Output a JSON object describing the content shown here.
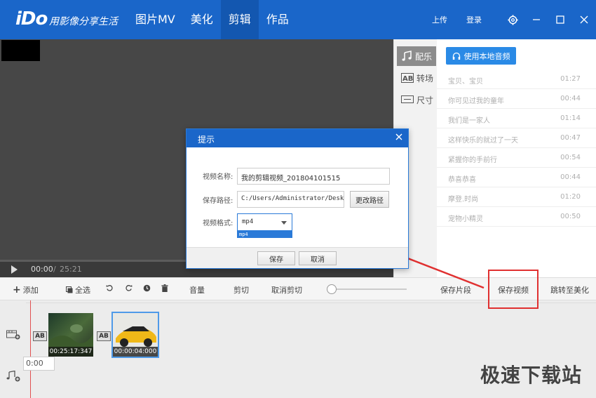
{
  "app": {
    "logo": "iDo",
    "slogan": "用影像分享生活"
  },
  "nav": [
    {
      "label": "图片MV"
    },
    {
      "label": "美化"
    },
    {
      "label": "剪辑"
    },
    {
      "label": "作品"
    }
  ],
  "top_links": {
    "upload": "上传",
    "login": "登录"
  },
  "player": {
    "current_time": "00:00",
    "separator": "/",
    "total_time": "25:21"
  },
  "side_tabs": [
    {
      "label": "配乐",
      "icon": "music-note-icon"
    },
    {
      "label": "转场",
      "icon": "ab-transition-icon"
    },
    {
      "label": "尺寸",
      "icon": "size-icon"
    }
  ],
  "music": {
    "local_button": "使用本地音频",
    "items": [
      {
        "title": "宝贝、宝贝",
        "duration": "01:27"
      },
      {
        "title": "你可见过我的童年",
        "duration": "00:44"
      },
      {
        "title": "我们是一家人",
        "duration": "01:14"
      },
      {
        "title": "这样快乐的就过了一天",
        "duration": "00:47"
      },
      {
        "title": "紧握你的手前行",
        "duration": "00:54"
      },
      {
        "title": "恭喜恭喜",
        "duration": "00:44"
      },
      {
        "title": "摩登.时尚",
        "duration": "01:20"
      },
      {
        "title": "宠物小精灵",
        "duration": "00:50"
      }
    ]
  },
  "toolbar": {
    "add": "添加",
    "select_all": "全选",
    "volume": "音量",
    "cut": "剪切",
    "cancel_cut": "取消剪切",
    "save_segment": "保存片段",
    "save_video": "保存视频",
    "goto_beautify": "跳转至美化"
  },
  "timeline": {
    "clips": [
      {
        "time": "00:25:17:347"
      },
      {
        "time": "00:00:04:000"
      }
    ],
    "ab_label": "AB",
    "time_display": "0:00"
  },
  "dialog": {
    "title": "提示",
    "name_label": "视频名称:",
    "name_value": "我的剪辑视频_201804101515",
    "path_label": "保存路径:",
    "path_value": "C:/Users/Administrator/Desktop",
    "change_path": "更改路径",
    "format_label": "视频格式:",
    "format_value": "mp4",
    "format_options": [
      "mp4"
    ],
    "save": "保存",
    "cancel": "取消"
  },
  "watermark": "极速下载站",
  "colors": {
    "brand_blue": "#1a66c9",
    "accent_blue": "#2a8ae6",
    "highlight_red": "#e03030"
  }
}
